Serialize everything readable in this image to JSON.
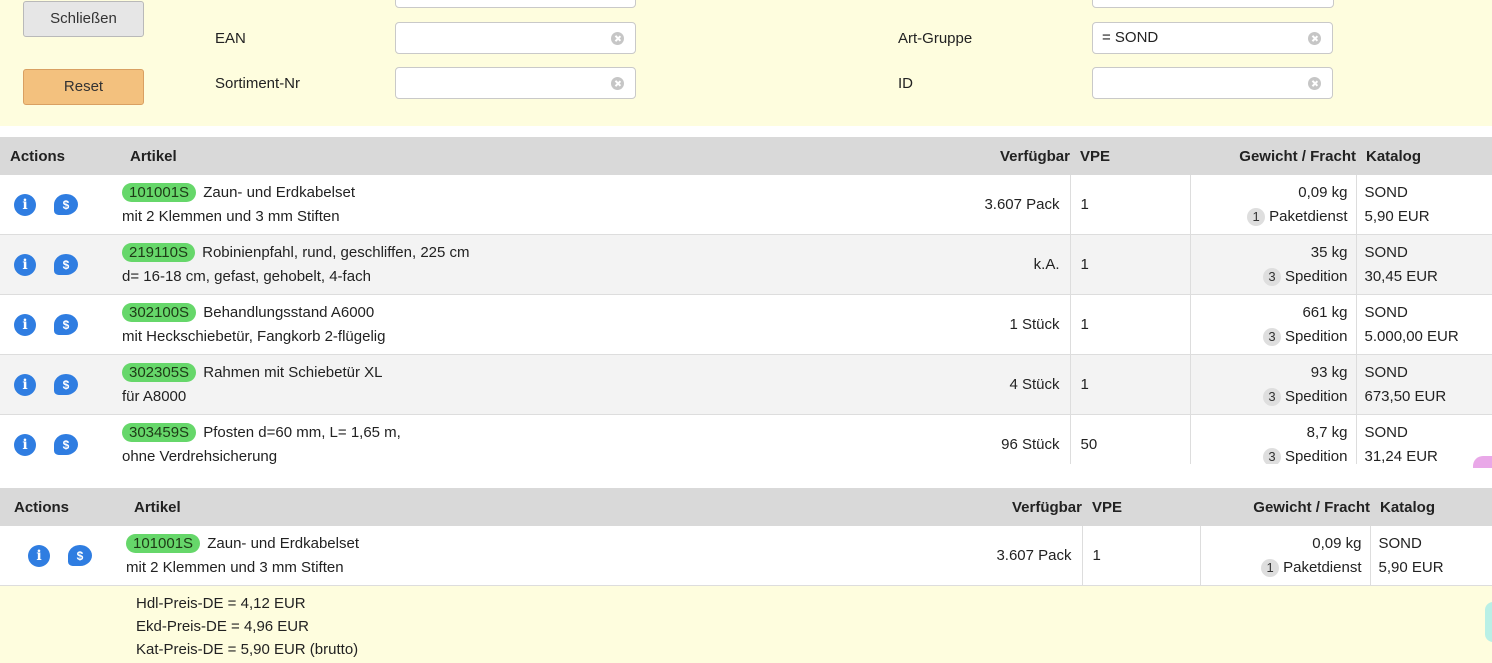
{
  "filters": {
    "close_label": "Schließen",
    "reset_label": "Reset",
    "ean_label": "EAN",
    "ean_value": "",
    "sortiment_label": "Sortiment-Nr",
    "sortiment_value": "",
    "artgruppe_label": "Art-Gruppe",
    "artgruppe_value": "= SOND",
    "id_label": "ID",
    "id_value": ""
  },
  "table_headers": {
    "actions": "Actions",
    "artikel": "Artikel",
    "verfuegbar": "Verfügbar",
    "vpe": "VPE",
    "gewicht": "Gewicht / Fracht",
    "katalog": "Katalog"
  },
  "rows": [
    {
      "sku": "101001S",
      "title": "Zaun- und Erdkabelset",
      "subtitle": "mit 2 Klemmen und 3 mm Stiften",
      "available": "3.607 Pack",
      "vpe": "1",
      "weight": "0,09 kg",
      "freight_rank": "1",
      "freight": "Paketdienst",
      "catalog": "SOND",
      "price": "5,90 EUR"
    },
    {
      "sku": "219110S",
      "title": "Robinienpfahl, rund, geschliffen, 225 cm",
      "subtitle": "d= 16-18 cm, gefast, gehobelt, 4-fach",
      "available": "k.A.",
      "vpe": "1",
      "weight": "35 kg",
      "freight_rank": "3",
      "freight": "Spedition",
      "catalog": "SOND",
      "price": "30,45 EUR"
    },
    {
      "sku": "302100S",
      "title": "Behandlungsstand A6000",
      "subtitle": "mit Heckschiebetür, Fangkorb 2-flügelig",
      "available": "1 Stück",
      "vpe": "1",
      "weight": "661 kg",
      "freight_rank": "3",
      "freight": "Spedition",
      "catalog": "SOND",
      "price": "5.000,00 EUR"
    },
    {
      "sku": "302305S",
      "title": "Rahmen mit Schiebetür XL",
      "subtitle": "für A8000",
      "available": "4 Stück",
      "vpe": "1",
      "weight": "93 kg",
      "freight_rank": "3",
      "freight": "Spedition",
      "catalog": "SOND",
      "price": "673,50 EUR"
    },
    {
      "sku": "303459S",
      "title": "Pfosten d=60 mm, L= 1,65 m,",
      "subtitle": "ohne Verdrehsicherung",
      "available": "96 Stück",
      "vpe": "50",
      "weight": "8,7 kg",
      "freight_rank": "3",
      "freight": "Spedition",
      "catalog": "SOND",
      "price": "31,24 EUR"
    }
  ],
  "selected": {
    "sku": "101001S",
    "title": "Zaun- und Erdkabelset",
    "subtitle": "mit 2 Klemmen und 3 mm Stiften",
    "available": "3.607 Pack",
    "vpe": "1",
    "weight": "0,09 kg",
    "freight_rank": "1",
    "freight": "Paketdienst",
    "catalog": "SOND",
    "price": "5,90 EUR",
    "prices": [
      "Hdl-Preis-DE = 4,12 EUR",
      "Ekd-Preis-DE = 4,96 EUR",
      "Kat-Preis-DE = 5,90 EUR (brutto)"
    ]
  },
  "icons": {
    "info": "info-icon",
    "price": "price-bubble-icon",
    "clear": "clear-icon"
  },
  "colors": {
    "sku_badge": "#66d76a",
    "info_icon": "#2f7de1",
    "panel_bg": "#fefdde",
    "reset_button": "#f3c17e"
  }
}
